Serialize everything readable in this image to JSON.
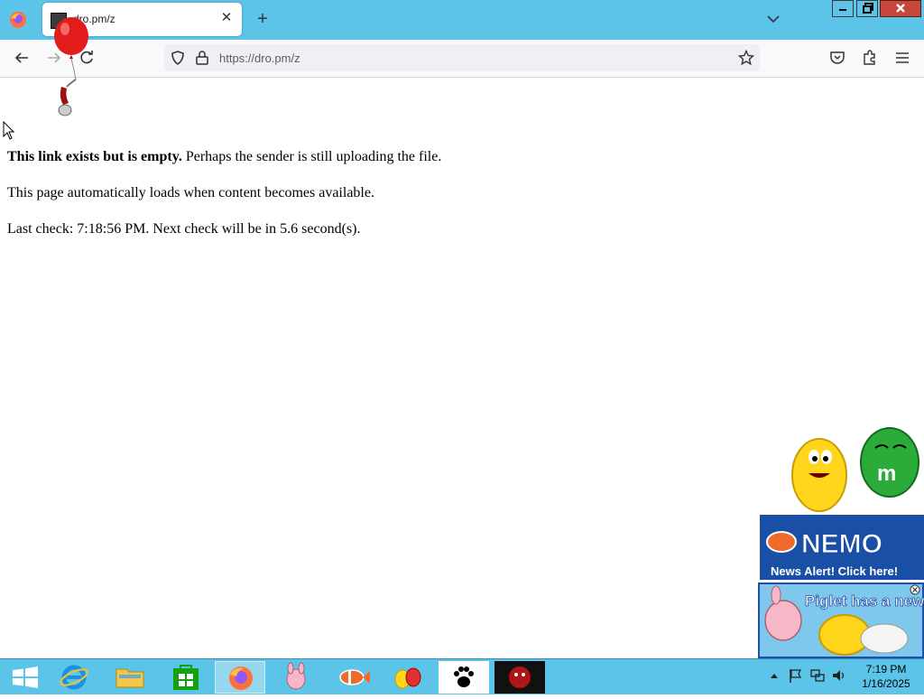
{
  "browser": {
    "tab": {
      "title": "dro.pm/z"
    },
    "url": "https://dro.pm/z"
  },
  "page": {
    "line1_bold": "This link exists but is empty.",
    "line1_rest": " Perhaps the sender is still uploading the file.",
    "line2": "This page automatically loads when content becomes available.",
    "line3": "Last check: 7:18:56 PM. Next check will be in 5.6 second(s)."
  },
  "ads": {
    "mm_banner": "News Alert! Click here!",
    "mm_logo": "NEMO",
    "piglet_banner": "Piglet has a new  for you!"
  },
  "taskbar": {
    "time": "7:19 PM",
    "date": "1/16/2025"
  },
  "colors": {
    "accent": "#5bc4e8",
    "close_button": "#c7483b",
    "balloon": "#e21b1b"
  }
}
